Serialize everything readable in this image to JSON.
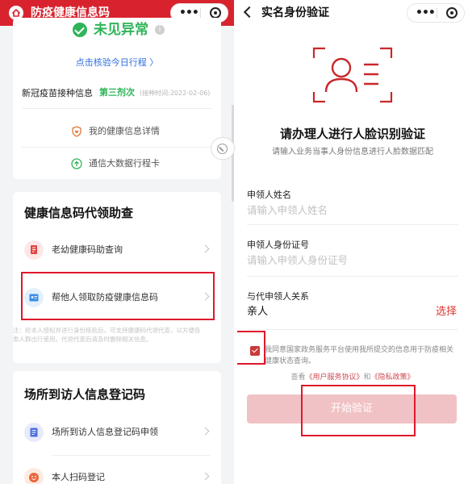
{
  "left": {
    "title": "防疫健康信息码",
    "status": "未见异常",
    "info_icon": "i",
    "verify_link": "点击核验今日行程 〉",
    "vaccine": {
      "label": "新冠疫苗接种信息",
      "dose": "第三剂次",
      "time": "(接种时间:2022-02-06)"
    },
    "links": [
      {
        "label": "我的健康信息详情",
        "icon": "shield-heart-icon"
      },
      {
        "label": "通信大数据行程卡",
        "icon": "upload-circle-icon"
      }
    ],
    "proxy_card": {
      "title": "健康信息码代领助查",
      "items": [
        {
          "label": "老幼健康码助查询",
          "icon": "document-icon"
        },
        {
          "label": "帮他人领取防疫健康信息码",
          "icon": "card-icon"
        }
      ],
      "note": "注：经本人授权并进行身份核验后，可支持健康码代领代查，以方便各类人群出行使用。代领代查后请及时删除相关信息。"
    },
    "visitor_card": {
      "title": "场所到访人信息登记码",
      "items": [
        {
          "label": "场所到访人信息登记码申领",
          "icon": "form-icon"
        },
        {
          "label": "本人扫码登记",
          "icon": "smile-icon"
        }
      ]
    }
  },
  "right": {
    "title": "实名身份验证",
    "heading": "请办理人进行人脸识别验证",
    "subheading": "请输入业务当事人身份信息进行人脸数据匹配",
    "fields": {
      "name_label": "申领人姓名",
      "name_placeholder": "请输入申领人姓名",
      "id_label": "申领人身份证号",
      "id_placeholder": "请输入申领人身份证号",
      "relation_label": "与代申领人关系",
      "relation_value": "亲人",
      "relation_action": "选择"
    },
    "agreement": "我同意国家政务服务平台使用我所提交的信息用于防疫相关健康状态查询。",
    "policy_prefix": "查看",
    "policy_link1": "《用户服务协议》",
    "policy_and": "和",
    "policy_link2": "《隐私政策》",
    "start_button": "开始验证"
  },
  "colors": {
    "brand_red": "#d8232f",
    "healthy_green": "#2fb45a",
    "link_blue": "#2f6fdb",
    "button_pink": "#f1c2c5",
    "annotation_red": "#e0182b"
  }
}
